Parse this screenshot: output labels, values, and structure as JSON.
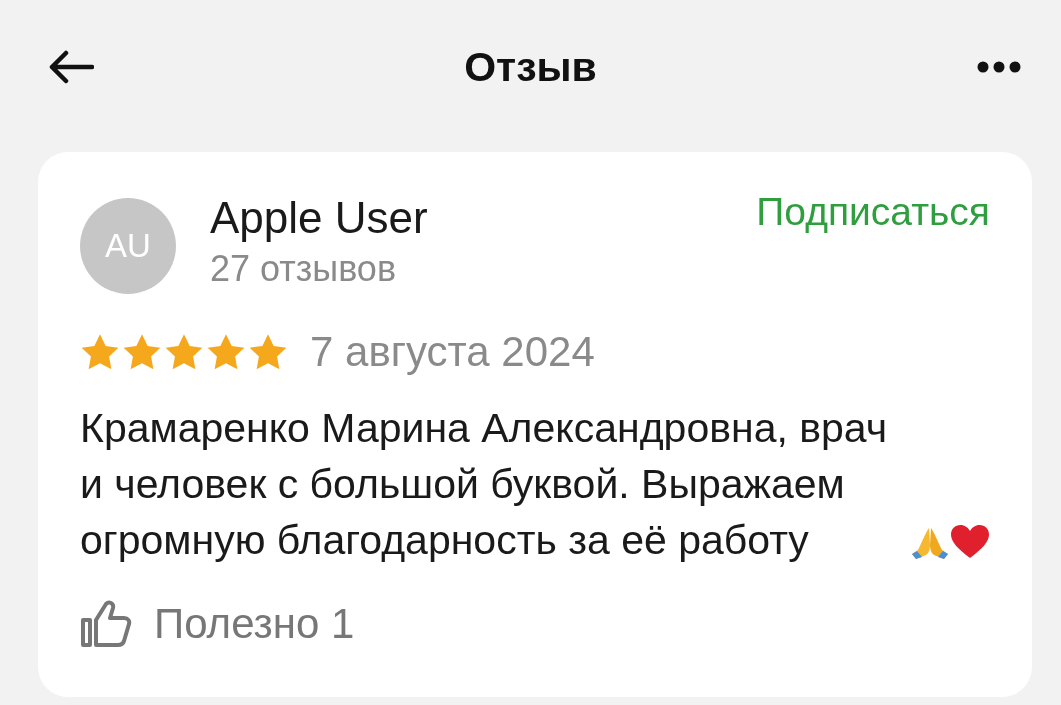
{
  "header": {
    "title": "Отзыв"
  },
  "review": {
    "author": {
      "initials": "AU",
      "name": "Apple User",
      "reviews_count": "27 отзывов"
    },
    "subscribe": "Подписаться",
    "stars": 5,
    "date": "7 августа 2024",
    "text": "Крамаренко Марина Александровна, врач и человек с большой буквой. Выражаем огромную благодарность за её работу",
    "emoji": [
      {
        "kind": "pray"
      },
      {
        "kind": "heart"
      }
    ],
    "helpful": {
      "label": "Полезно",
      "count": "1"
    }
  }
}
